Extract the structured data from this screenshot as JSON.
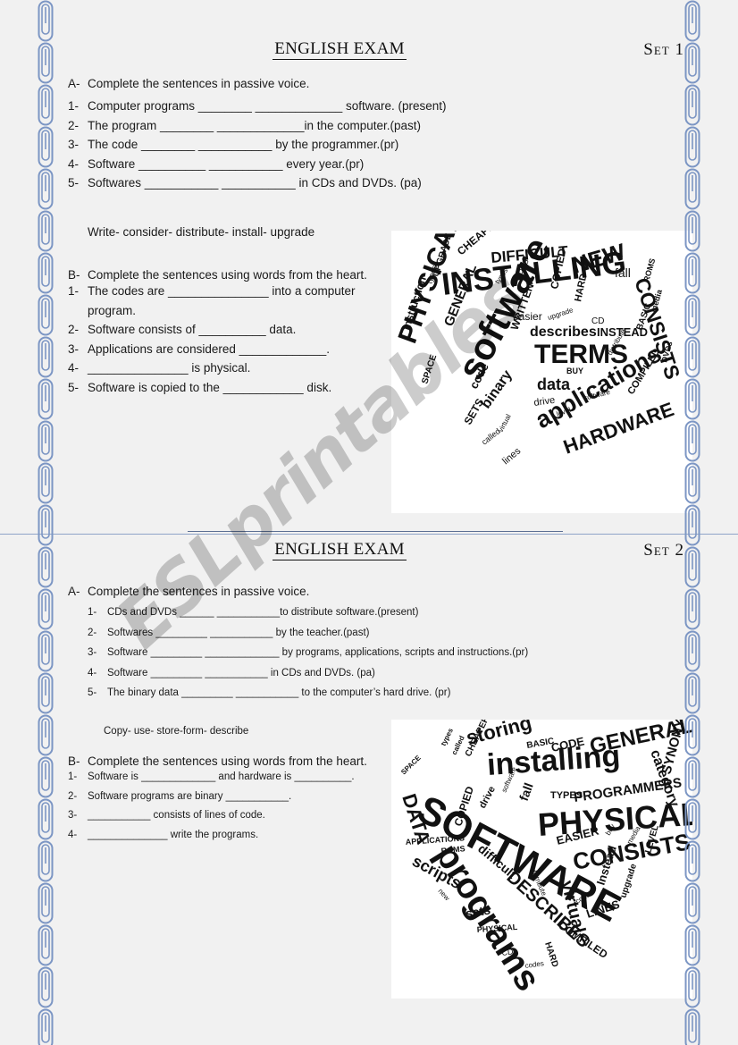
{
  "page": {
    "background_color": "#f1f1f1",
    "watermark_text": "ESLprintables",
    "watermark_color": "#cccccc",
    "clip_icon_name": "paperclip-icon",
    "clip_color": "#7c96c4"
  },
  "sets": [
    {
      "title": "ENGLISH EXAM",
      "set_label": "Set 1",
      "section_a": {
        "letter": "A-",
        "instruction": "Complete the sentences in passive voice.",
        "items": [
          {
            "marker": "1-",
            "text": "Computer programs ________ _____________ software. (present)"
          },
          {
            "marker": "2-",
            "text": "The program ________ _____________in the computer.(past)"
          },
          {
            "marker": "3-",
            "text": "The code ________ ___________ by the programmer.(pr)"
          },
          {
            "marker": "4-",
            "text": "Software __________ ___________ every year.(pr)"
          },
          {
            "marker": "5-",
            "text": "Softwares ___________ ___________ in CDs and DVDs. (pa)"
          }
        ],
        "word_bank": "Write- consider- distribute- install- upgrade"
      },
      "section_b": {
        "letter": "B-",
        "instruction": "Complete the sentences using words from the heart.",
        "items": [
          {
            "marker": "1-",
            "text": "The codes are _______________ into a computer program."
          },
          {
            "marker": "2-",
            "text": "Software consists of __________ data."
          },
          {
            "marker": "3-",
            "text": "Applications are considered _____________."
          },
          {
            "marker": "4-",
            "text": "_______________ is physical."
          },
          {
            "marker": "5-",
            "text": "Software is copied to the ____________ disk."
          }
        ]
      },
      "word_cloud": {
        "name": "heart-word-cloud-set-1",
        "words": [
          "INSTALLING",
          "software",
          "PHYSICAL",
          "TERMS",
          "applications",
          "HARDWARE",
          "NEW",
          "CONSISTS",
          "DIFFICULT",
          "CHEAPER",
          "describes",
          "INSTEAD",
          "GENERAL",
          "data",
          "binary",
          "SETS",
          "WRITTEN",
          "code",
          "drive",
          "easier",
          "instruction",
          "SPACE",
          "lines",
          "COPIED",
          "HARD",
          "BASIC",
          "fall",
          "COMPILED",
          "UPGRADE",
          "called",
          "CD",
          "DVDs",
          "BUY",
          "CODES",
          "virtual",
          "media",
          "types",
          "level"
        ]
      }
    },
    {
      "title": "ENGLISH EXAM",
      "set_label": "Set 2",
      "section_a": {
        "letter": "A-",
        "instruction": "Complete the sentences in passive voice.",
        "items": [
          {
            "marker": "1-",
            "text": "CDs and DVDs ______ ___________to distribute software.(present)"
          },
          {
            "marker": "2-",
            "text": "Softwares _________ ___________ by the teacher.(past)"
          },
          {
            "marker": "3-",
            "text": "Software _________ _____________ by programs, applications, scripts and instructions.(pr)"
          },
          {
            "marker": "4-",
            "text": "Software _________ ___________ in CDs and DVDs. (pa)"
          },
          {
            "marker": "5-",
            "text": "The binary data _________ ___________ to the computer’s hard drive. (pr)"
          }
        ],
        "word_bank": "Copy- use- store-form-  describe"
      },
      "section_b": {
        "letter": "B-",
        "instruction": "Complete the sentences using words from the heart.",
        "items": [
          {
            "marker": "1-",
            "text": "Software is _____________ and hardware is __________."
          },
          {
            "marker": "2-",
            "text": "Software programs are binary ___________."
          },
          {
            "marker": "3-",
            "text": "___________ consists of lines of code."
          },
          {
            "marker": "4-",
            "text": "______________ write the programs."
          }
        ]
      },
      "word_cloud": {
        "name": "heart-word-cloud-set-2",
        "words": [
          "SOFTWARE",
          "programs",
          "installing",
          "PHYSICAL",
          "CONSISTS",
          "GENERAL",
          "storing",
          "PROGRAMMERS",
          "DESCRIBES",
          "virtual",
          "DATA",
          "scripts",
          "category",
          "SYNONYMS",
          "difficult",
          "COPIED",
          "EASIER",
          "Instead",
          "LINES",
          "COMPILED",
          "sets",
          "fall",
          "CODE",
          "BASIC",
          "types",
          "CHEAPER",
          "drive",
          "HARD",
          "LEVEL",
          "upgrade",
          "PHYSICAL",
          "CD",
          "APPLICATIONS",
          "ROMS",
          "SPACE"
        ]
      }
    }
  ]
}
